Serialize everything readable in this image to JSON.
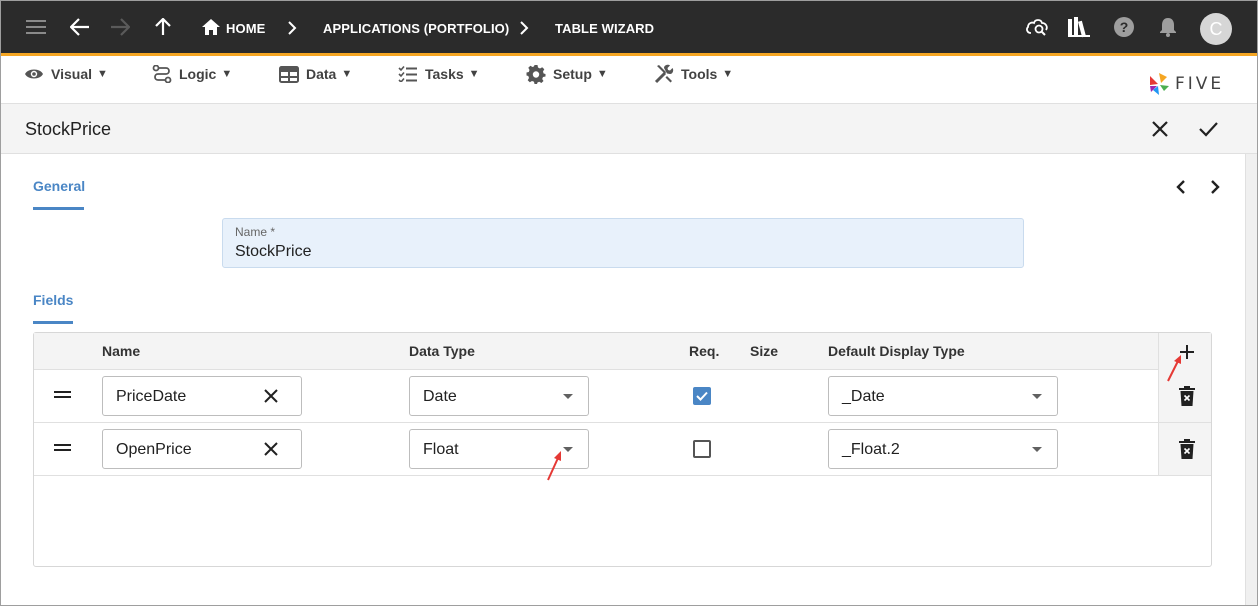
{
  "appbar": {
    "breadcrumbs": [
      "HOME",
      "APPLICATIONS (PORTFOLIO)",
      "TABLE WIZARD"
    ],
    "avatar_initial": "C",
    "colors": {
      "bar": "#2b2b2b",
      "accent": "#f5a623"
    }
  },
  "menu": {
    "items": [
      {
        "label": "Visual",
        "icon": "eye-icon"
      },
      {
        "label": "Logic",
        "icon": "logic-icon"
      },
      {
        "label": "Data",
        "icon": "table-icon"
      },
      {
        "label": "Tasks",
        "icon": "tasks-icon"
      },
      {
        "label": "Setup",
        "icon": "gear-icon"
      },
      {
        "label": "Tools",
        "icon": "tools-icon"
      }
    ],
    "caret": "▼",
    "logo_text": "FIVE"
  },
  "titlebar": {
    "title": "StockPrice"
  },
  "form": {
    "general_label": "General",
    "name_label": "Name *",
    "name_value": "StockPrice",
    "fields_label": "Fields"
  },
  "grid": {
    "columns": [
      "Name",
      "Data Type",
      "Req.",
      "Size",
      "Default Display Type"
    ],
    "rows": [
      {
        "name": "PriceDate",
        "data_type": "Date",
        "required": true,
        "size": "",
        "display_type": "_Date"
      },
      {
        "name": "OpenPrice",
        "data_type": "Float",
        "required": false,
        "size": "",
        "display_type": "_Float.2"
      }
    ]
  },
  "colors": {
    "link_blue": "#4a86c5",
    "annotation_red": "#e53935",
    "field_bg": "#e8f1fb"
  }
}
